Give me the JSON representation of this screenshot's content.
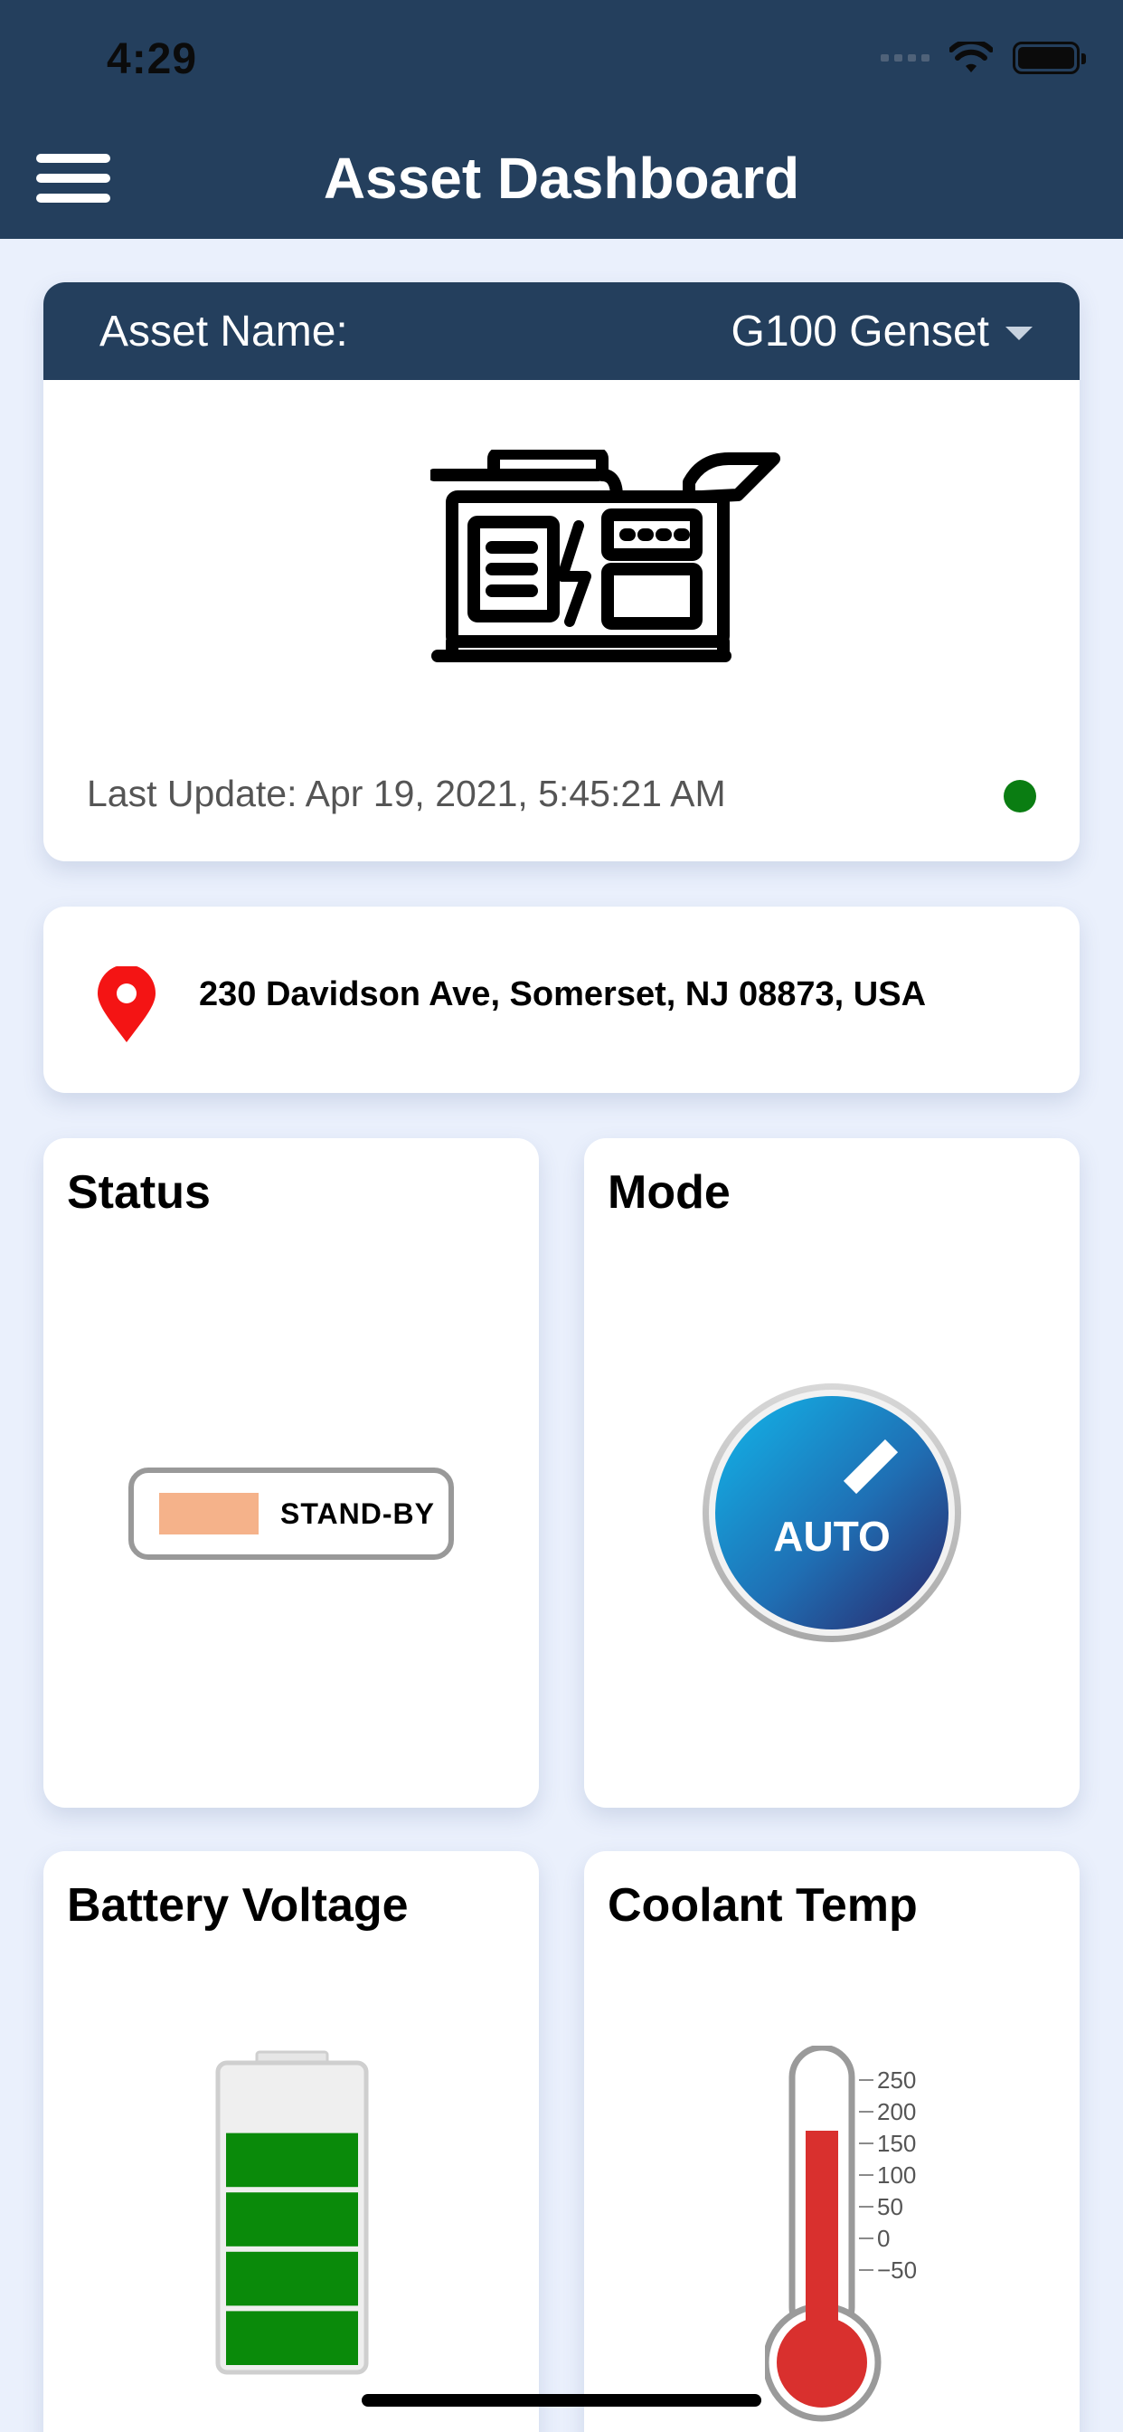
{
  "status_bar": {
    "time": "4:29"
  },
  "header": {
    "title": "Asset Dashboard"
  },
  "asset": {
    "name_label": "Asset Name:",
    "selected_asset": "G100 Genset",
    "last_update": "Last Update: Apr 19, 2021, 5:45:21 AM",
    "online_color": "#0a7d12"
  },
  "location": {
    "address": "230 Davidson Ave, Somerset, NJ 08873, USA"
  },
  "status_tile": {
    "title": "Status",
    "value": "STAND-BY",
    "swatch_color": "#f5b28a"
  },
  "mode_tile": {
    "title": "Mode",
    "value": "AUTO"
  },
  "battery_tile": {
    "title": "Battery Voltage",
    "fill_level": 0.8
  },
  "coolant_tile": {
    "title": "Coolant Temp",
    "scale_labels": [
      "250",
      "200",
      "150",
      "100",
      "50",
      "0",
      "−50"
    ],
    "mercury_value": 170
  },
  "colors": {
    "header": "#243f5d",
    "background": "#eaf0fc",
    "battery_fill": "#0a8a0a",
    "thermo_red": "#d9302e"
  }
}
